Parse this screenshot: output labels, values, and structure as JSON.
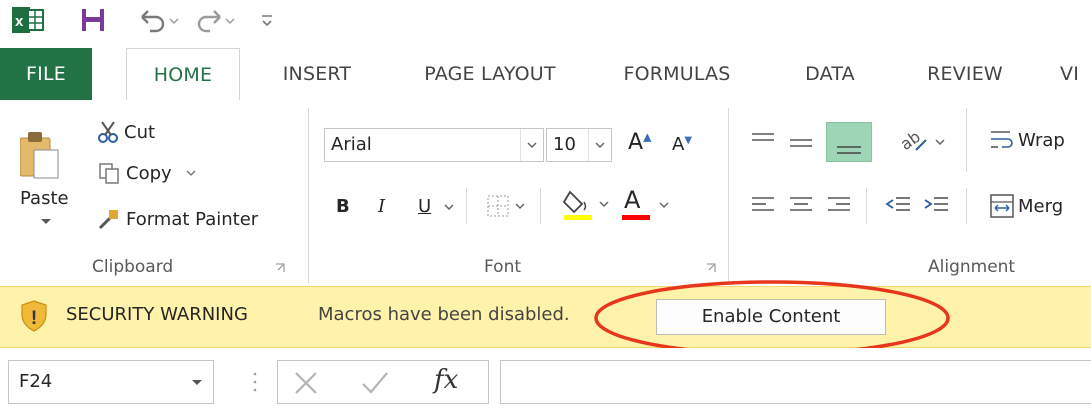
{
  "colors": {
    "excel_green": "#217346",
    "warning_bar": "#fff2aa",
    "annotation_red": "#e8361c",
    "fill_yellow": "#ffff00",
    "font_red": "#ff0000"
  },
  "tabs": {
    "file": "FILE",
    "home": "HOME",
    "insert": "INSERT",
    "page_layout": "PAGE LAYOUT",
    "formulas": "FORMULAS",
    "data": "DATA",
    "review": "REVIEW",
    "view_partial": "VI"
  },
  "clipboard": {
    "paste": "Paste",
    "cut": "Cut",
    "copy": "Copy",
    "format_painter": "Format Painter",
    "group_label": "Clipboard"
  },
  "font": {
    "name": "Arial",
    "size": "10",
    "grow_glyph": "A",
    "shrink_glyph": "A",
    "bold": "B",
    "italic": "I",
    "underline": "U",
    "font_color_glyph": "A",
    "group_label": "Font"
  },
  "alignment": {
    "wrap_partial": "Wrap",
    "merge_partial": "Merg",
    "group_label": "Alignment"
  },
  "security": {
    "title": "SECURITY WARNING",
    "message": "Macros have been disabled.",
    "button": "Enable Content",
    "icon_glyph": "!"
  },
  "formula_bar": {
    "name_box": "F24",
    "fx": "fx",
    "formula": ""
  }
}
